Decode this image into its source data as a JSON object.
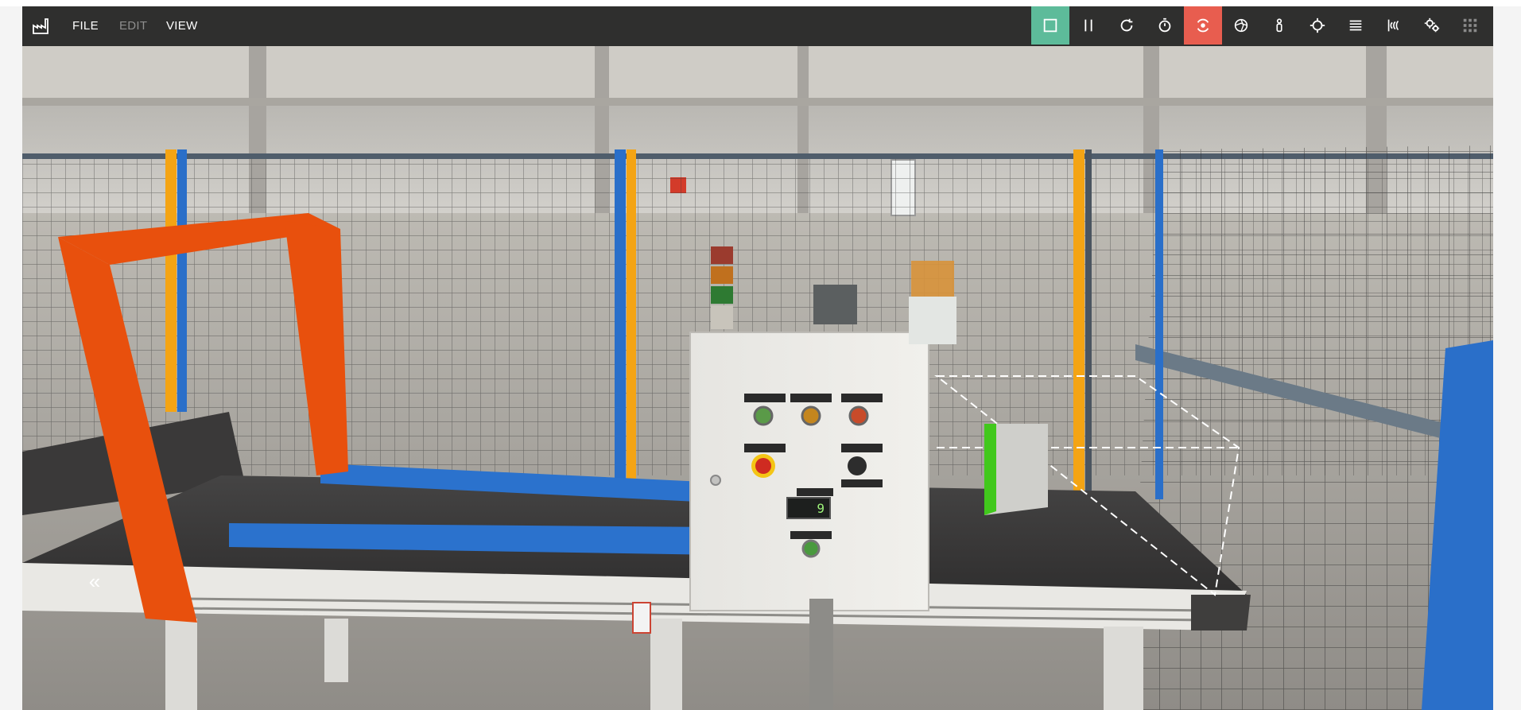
{
  "menu": {
    "file": "FILE",
    "edit": "EDIT",
    "view": "VIEW"
  },
  "toolbar": {
    "tools": [
      {
        "icon": "stop-icon",
        "state": "active-green"
      },
      {
        "icon": "pause-icon",
        "state": "normal"
      },
      {
        "icon": "reset-icon",
        "state": "normal"
      },
      {
        "icon": "timer-icon",
        "state": "normal"
      },
      {
        "icon": "orbit-camera-icon",
        "state": "active-red"
      },
      {
        "icon": "fly-camera-icon",
        "state": "normal"
      },
      {
        "icon": "first-person-icon",
        "state": "normal"
      },
      {
        "icon": "target-icon",
        "state": "normal"
      },
      {
        "icon": "list-icon",
        "state": "normal"
      },
      {
        "icon": "sensor-icon",
        "state": "normal"
      },
      {
        "icon": "settings-icon",
        "state": "normal"
      },
      {
        "icon": "grid-icon",
        "state": "disabled"
      }
    ]
  },
  "scene": {
    "counter_display": "9",
    "collapse_label": "«"
  },
  "colors": {
    "menubar": "#282828",
    "active_green": "#5dbb9a",
    "active_red": "#e85d4f",
    "gate_orange": "#e8500d",
    "rail_blue": "#2a6fc9",
    "box_green": "#41c81c"
  }
}
